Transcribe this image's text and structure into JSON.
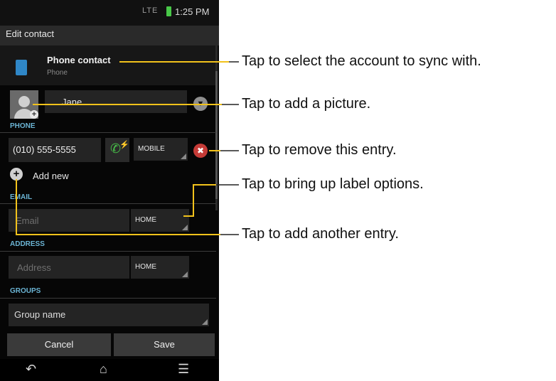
{
  "status_bar": {
    "network": "LTE",
    "time": "1:25 PM"
  },
  "header": {
    "title": "Edit contact"
  },
  "account": {
    "name": "Phone contact",
    "type": "Phone",
    "icon": "phone-icon"
  },
  "name": {
    "value": "Jane"
  },
  "phone_section": {
    "heading": "PHONE",
    "number": "(010) 555-5555",
    "label": "MOBILE",
    "add_new": "Add new"
  },
  "email_section": {
    "heading": "EMAIL",
    "placeholder": "Email",
    "label": "HOME"
  },
  "address_section": {
    "heading": "ADDRESS",
    "placeholder": "Address",
    "label": "HOME"
  },
  "groups_section": {
    "heading": "GROUPS",
    "placeholder": "Group name"
  },
  "buttons": {
    "cancel": "Cancel",
    "save": "Save"
  },
  "callouts": {
    "account": "Tap to select the account to sync with.",
    "picture": "Tap to add a picture.",
    "remove": "Tap to remove this entry.",
    "label": "Tap to bring up label options.",
    "add": "Tap to add another entry."
  },
  "colors": {
    "callout_line": "#f2c21b",
    "section_heading": "#6bb4d4",
    "remove": "#c53b37",
    "call": "#49c24a"
  }
}
